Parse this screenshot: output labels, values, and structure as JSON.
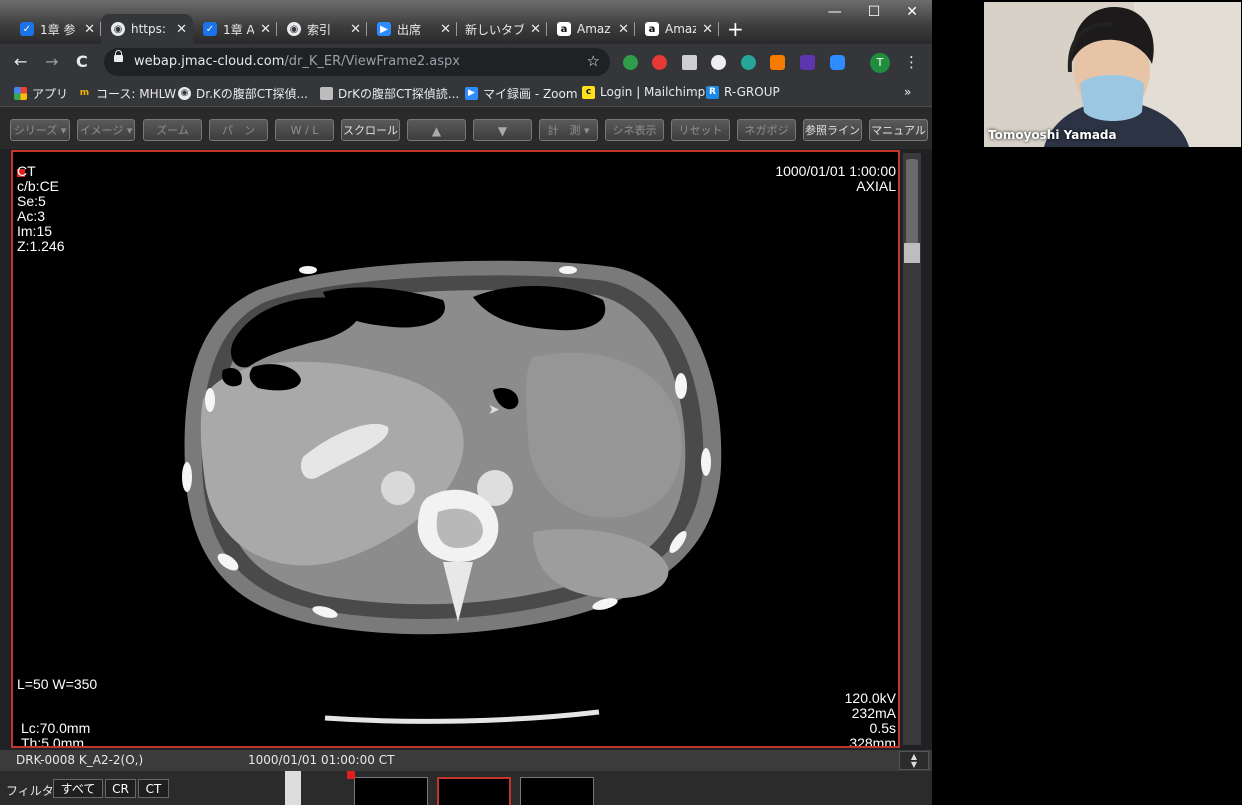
{
  "window": {
    "controls": [
      "—",
      "☐",
      "✕"
    ]
  },
  "tabs": [
    {
      "title": "1章 参",
      "icon": "checkbox-icon",
      "color": "#1a73e8"
    },
    {
      "title": "https:",
      "icon": "globe-icon",
      "color": "#5f6368",
      "active": true
    },
    {
      "title": "1章 A",
      "icon": "checkbox-icon",
      "color": "#1a73e8"
    },
    {
      "title": "索引",
      "icon": "globe-icon",
      "color": "#5f6368"
    },
    {
      "title": "出席",
      "icon": "zoom-icon",
      "color": "#2d8cff"
    },
    {
      "title": "新しいタブ",
      "icon": "none"
    },
    {
      "title": "Amaz",
      "icon": "amazon-icon",
      "color": "#ffffff"
    },
    {
      "title": "Amaz",
      "icon": "amazon-icon",
      "color": "#ffffff"
    }
  ],
  "new_tab": "+",
  "nav": {
    "back": "←",
    "forward": "→",
    "reload": "C"
  },
  "address": {
    "host": "webap.jmac-cloud.com",
    "path": "/dr_K_ER/ViewFrame2.aspx",
    "star": "☆"
  },
  "profile_initial": "T",
  "menu_glyph": "⋮",
  "bookmarks": [
    {
      "label": "アプリ",
      "icon": "apps-grid-icon"
    },
    {
      "label": "コース: MHLW",
      "icon": "m-logo-icon"
    },
    {
      "label": "Dr.Kの腹部CT探偵...",
      "icon": "globe-icon"
    },
    {
      "label": "DrKの腹部CT探偵読...",
      "icon": "bookmark-image-icon"
    },
    {
      "label": "マイ録画 - Zoom",
      "icon": "zoom-icon"
    },
    {
      "label": "Login | Mailchimp",
      "icon": "mailchimp-icon"
    },
    {
      "label": "R-GROUP",
      "icon": "r-group-icon"
    }
  ],
  "bookmarks_more": "»",
  "toolbar": {
    "buttons": [
      {
        "label": "シリーズ ▾",
        "on": false
      },
      {
        "label": "イメージ ▾",
        "on": false
      },
      {
        "label": "ズーム",
        "on": false
      },
      {
        "label": "パ　ン",
        "on": false
      },
      {
        "label": "W / L",
        "on": false
      },
      {
        "label": "スクロール",
        "on": true
      },
      {
        "label": "▲",
        "on": false
      },
      {
        "label": "▼",
        "on": false
      },
      {
        "label": "計　測 ▾",
        "on": false
      },
      {
        "label": "シネ表示",
        "on": false
      },
      {
        "label": "リセット",
        "on": false
      },
      {
        "label": "ネガポジ",
        "on": false
      },
      {
        "label": "参照ライン",
        "on": true
      },
      {
        "label": "マニュアル",
        "on": true
      }
    ]
  },
  "overlay": {
    "top_left": [
      "CT",
      "c/b:CE",
      "Se:5",
      "Ac:3",
      "Im:15",
      "Z:1.246"
    ],
    "top_right": [
      "1000/01/01 1:00:00",
      "AXIAL"
    ],
    "window_level": "L=50 W=350",
    "bottom_left": [
      "Lc:70.0mm",
      "Th:5.0mm"
    ],
    "bottom_right": [
      "120.0kV",
      "232mA",
      "0.5s",
      "328mm"
    ]
  },
  "status": {
    "patient": "DRK-0008 K_A2-2(O,)",
    "study": "1000/01/01 01:00:00 CT"
  },
  "filter": {
    "label": "フィルタ:",
    "options": [
      "すべて",
      "CR",
      "CT"
    ]
  },
  "participant": {
    "name": "Tomoyoshi Yamada"
  },
  "colors": {
    "frame": "#c0362c",
    "chrome": "#35363a",
    "accent": "#e02020"
  }
}
